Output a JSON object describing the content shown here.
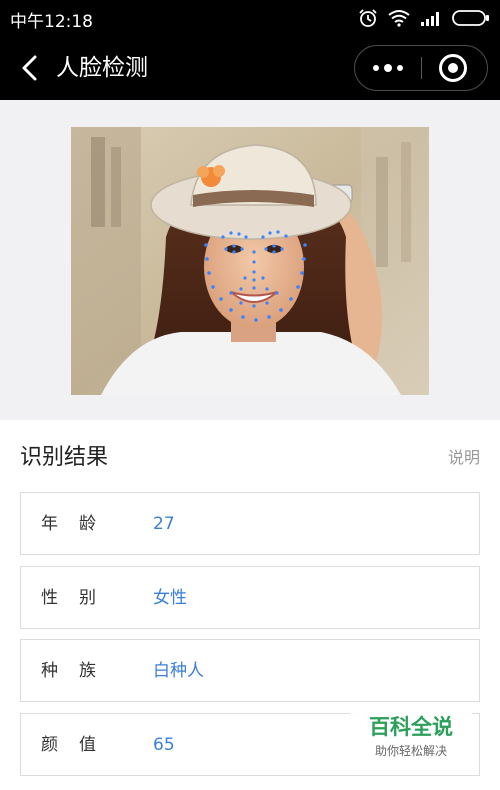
{
  "status_bar": {
    "time": "中午12:18",
    "icons": [
      "alarm-icon",
      "wifi-icon",
      "signal-icon",
      "battery-icon"
    ]
  },
  "nav": {
    "back_icon": "chevron-left-icon",
    "title": "人脸检测",
    "more_icon": "more-dots-icon",
    "close_icon": "target-close-icon"
  },
  "photo": {
    "subject": "woman-with-hat-face-landmarks",
    "landmark_color": "#3b82ff"
  },
  "results": {
    "title": "识别结果",
    "help_link": "说明",
    "rows": [
      {
        "label": "年龄",
        "value": "27"
      },
      {
        "label": "性别",
        "value": "女性"
      },
      {
        "label": "种族",
        "value": "白种人"
      },
      {
        "label": "颜值",
        "value": "65"
      }
    ]
  },
  "watermark": {
    "title": "百科全说",
    "subtitle": "助你轻松解决"
  },
  "colors": {
    "value_blue": "#3b7fd6",
    "brand_green": "#2aa05a",
    "bar_black": "#000000"
  }
}
